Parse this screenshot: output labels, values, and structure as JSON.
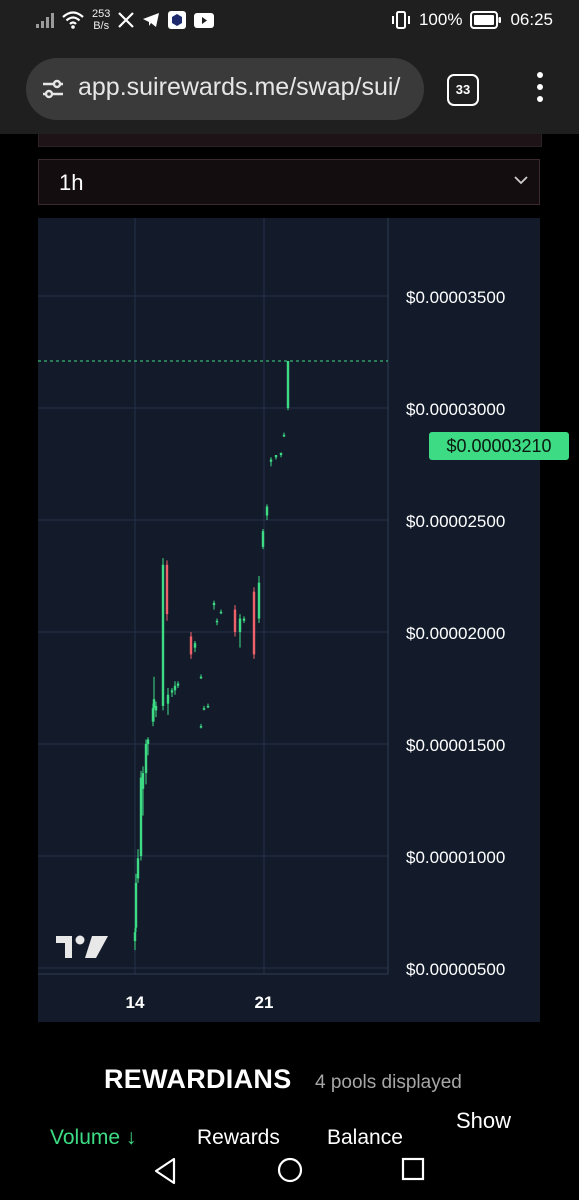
{
  "status_bar": {
    "network_speed_value": "253",
    "network_speed_unit": "B/s",
    "battery_percent": "100%",
    "time": "06:25"
  },
  "browser": {
    "url": "app.suirewards.me/swap/sui/",
    "tab_count": "33"
  },
  "timeframe": {
    "selected": "1h"
  },
  "chart_data": {
    "type": "candlestick",
    "x_tick_labels": [
      "14",
      "21"
    ],
    "y_tick_labels": [
      "$0.00003500",
      "$0.00003000",
      "$0.00002500",
      "$0.00002000",
      "$0.00001500",
      "$0.00001000",
      "$0.00000500"
    ],
    "y_ticks": [
      3.5e-05,
      3e-05,
      2.5e-05,
      2e-05,
      1.5e-05,
      1e-05,
      5e-06
    ],
    "current_price_label": "$0.00003210",
    "current_price": 3.21e-05,
    "up_color": "#3ddc84",
    "down_color": "#f0626a",
    "grid": true,
    "candles": [
      {
        "o": 6.2e-06,
        "h": 6.8e-06,
        "l": 5.8e-06,
        "c": 6.6e-06
      },
      {
        "o": 6.8e-06,
        "h": 9.2e-06,
        "l": 6.6e-06,
        "c": 8.8e-06
      },
      {
        "o": 9e-06,
        "h": 1.03e-05,
        "l": 8.8e-06,
        "c": 9.9e-06
      },
      {
        "o": 1e-05,
        "h": 1.38e-05,
        "l": 9.8e-06,
        "c": 1.35e-05
      },
      {
        "o": 1.3e-05,
        "h": 1.4e-05,
        "l": 1.18e-05,
        "c": 1.37e-05
      },
      {
        "o": 1.37e-05,
        "h": 1.52e-05,
        "l": 1.32e-05,
        "c": 1.5e-05
      },
      {
        "o": 1.5e-05,
        "h": 1.53e-05,
        "l": 1.45e-05,
        "c": 1.52e-05
      },
      {
        "o": 1.6e-05,
        "h": 1.68e-05,
        "l": 1.58e-05,
        "c": 1.66e-05
      },
      {
        "o": 1.66e-05,
        "h": 1.8e-05,
        "l": 1.6e-05,
        "c": 1.7e-05
      },
      {
        "o": 1.65e-05,
        "h": 1.69e-05,
        "l": 1.62e-05,
        "c": 1.67e-05
      },
      {
        "o": 1.67e-05,
        "h": 2.33e-05,
        "l": 1.65e-05,
        "c": 2.3e-05
      },
      {
        "o": 2.3e-05,
        "h": 2.32e-05,
        "l": 2.05e-05,
        "c": 2.08e-05
      },
      {
        "o": 1.68e-05,
        "h": 1.75e-05,
        "l": 1.63e-05,
        "c": 1.72e-05
      },
      {
        "o": 1.73e-05,
        "h": 1.75e-05,
        "l": 1.71e-05,
        "c": 1.74e-05
      },
      {
        "o": 1.74e-05,
        "h": 1.78e-05,
        "l": 1.72e-05,
        "c": 1.76e-05
      },
      {
        "o": 1.76e-05,
        "h": 1.78e-05,
        "l": 1.75e-05,
        "c": 1.77e-05
      },
      {
        "o": 1.98e-05,
        "h": 2e-05,
        "l": 1.88e-05,
        "c": 1.9e-05
      },
      {
        "o": 1.93e-05,
        "h": 1.96e-05,
        "l": 1.91e-05,
        "c": 1.95e-05
      },
      {
        "o": 1.8e-05,
        "h": 1.81e-05,
        "l": 1.79e-05,
        "c": 1.8e-05
      },
      {
        "o": 1.58e-05,
        "h": 1.59e-05,
        "l": 1.57e-05,
        "c": 1.58e-05
      },
      {
        "o": 1.66e-05,
        "h": 1.67e-05,
        "l": 1.65e-05,
        "c": 1.66e-05
      },
      {
        "o": 1.67e-05,
        "h": 1.68e-05,
        "l": 1.66e-05,
        "c": 1.67e-05
      },
      {
        "o": 2.12e-05,
        "h": 2.14e-05,
        "l": 2.1e-05,
        "c": 2.13e-05
      },
      {
        "o": 2.05e-05,
        "h": 2.06e-05,
        "l": 2.03e-05,
        "c": 2.05e-05
      },
      {
        "o": 2.09e-05,
        "h": 2.1e-05,
        "l": 2.08e-05,
        "c": 2.09e-05
      },
      {
        "o": 2.1e-05,
        "h": 2.12e-05,
        "l": 1.98e-05,
        "c": 2e-05
      },
      {
        "o": 2e-05,
        "h": 2.08e-05,
        "l": 1.93e-05,
        "c": 2.06e-05
      },
      {
        "o": 2.05e-05,
        "h": 2.07e-05,
        "l": 2.04e-05,
        "c": 2.06e-05
      },
      {
        "o": 2.18e-05,
        "h": 2.2e-05,
        "l": 1.88e-05,
        "c": 1.9e-05
      },
      {
        "o": 2.06e-05,
        "h": 2.25e-05,
        "l": 2.04e-05,
        "c": 2.22e-05
      },
      {
        "o": 2.38e-05,
        "h": 2.46e-05,
        "l": 2.37e-05,
        "c": 2.45e-05
      },
      {
        "o": 2.52e-05,
        "h": 2.57e-05,
        "l": 2.5e-05,
        "c": 2.56e-05
      },
      {
        "o": 2.76e-05,
        "h": 2.78e-05,
        "l": 2.74e-05,
        "c": 2.77e-05
      },
      {
        "o": 2.78e-05,
        "h": 2.79e-05,
        "l": 2.77e-05,
        "c": 2.79e-05
      },
      {
        "o": 2.79e-05,
        "h": 2.8e-05,
        "l": 2.78e-05,
        "c": 2.8e-05
      },
      {
        "o": 2.88e-05,
        "h": 2.89e-05,
        "l": 2.87e-05,
        "c": 2.88e-05
      },
      {
        "o": 3e-05,
        "h": 3.21e-05,
        "l": 2.99e-05,
        "c": 3.21e-05
      }
    ]
  },
  "pools": {
    "title": "REWARDIANS",
    "count_label": "4 pools displayed",
    "show_label": "Show",
    "tabs": [
      "Volume ↓",
      "Rewards",
      "Balance"
    ]
  },
  "nav": {
    "back": "back-icon",
    "home": "home-icon",
    "recents": "recents-icon"
  }
}
